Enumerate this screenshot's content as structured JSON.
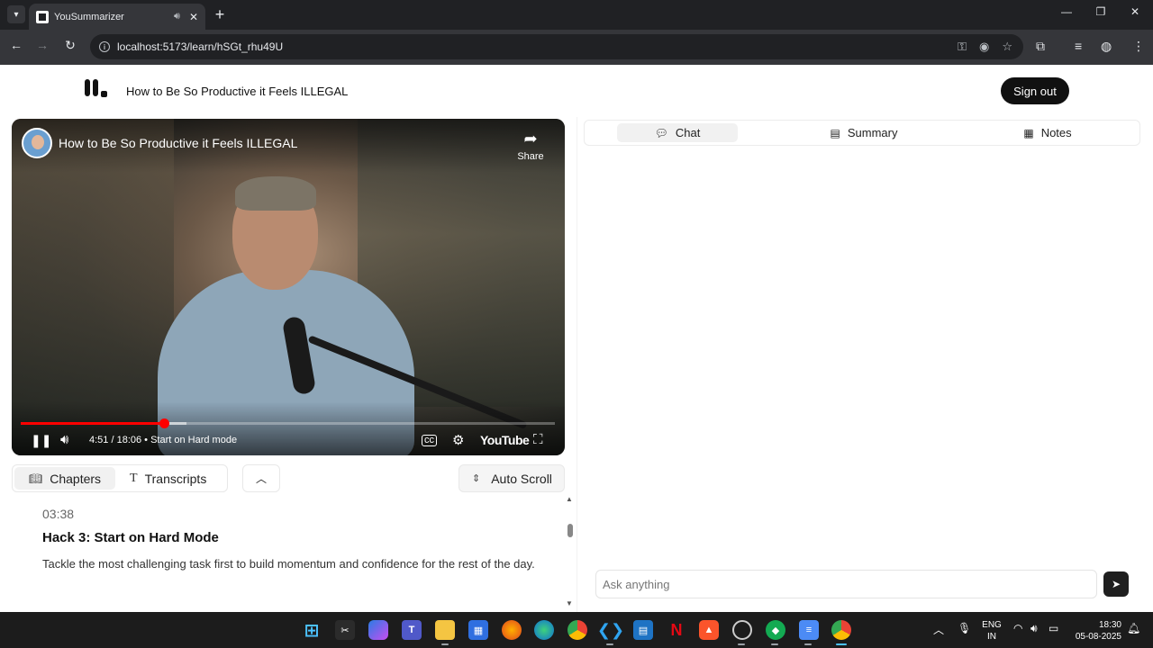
{
  "browser": {
    "tab_title": "YouSummarizer",
    "url": "localhost:5173/learn/hSGt_rhu49U"
  },
  "header": {
    "page_title": "How to Be So Productive it Feels ILLEGAL",
    "signout_label": "Sign out"
  },
  "video": {
    "title": "How to Be So Productive it Feels ILLEGAL",
    "share_label": "Share",
    "time": "4:51 / 18:06",
    "chapter_name": "Start on Hard mode",
    "time_and_chapter": "4:51 / 18:06 • Start on Hard mode",
    "progress_fraction": 0.268,
    "loaded_fraction": 0.31,
    "youtube_label": "YouTube"
  },
  "left_tabs": [
    {
      "label": "Chapters",
      "icon": "book-icon",
      "active": true
    },
    {
      "label": "Transcripts",
      "icon": "text-icon",
      "active": false
    }
  ],
  "autoscroll_label": "Auto Scroll",
  "chapter": {
    "time": "03:38",
    "title": "Hack 3: Start on Hard Mode",
    "description": "Tackle the most challenging task first to build momentum and confidence for the rest of the day."
  },
  "right_tabs": [
    {
      "label": "Chat",
      "icon": "chat-icon",
      "active": true
    },
    {
      "label": "Summary",
      "icon": "summary-icon",
      "active": false
    },
    {
      "label": "Notes",
      "icon": "notes-icon",
      "active": false
    }
  ],
  "chat": {
    "placeholder": "Ask anything"
  },
  "taskbar": {
    "lang_line1": "ENG",
    "lang_line2": "IN",
    "time": "18:30",
    "date": "05-08-2025"
  }
}
